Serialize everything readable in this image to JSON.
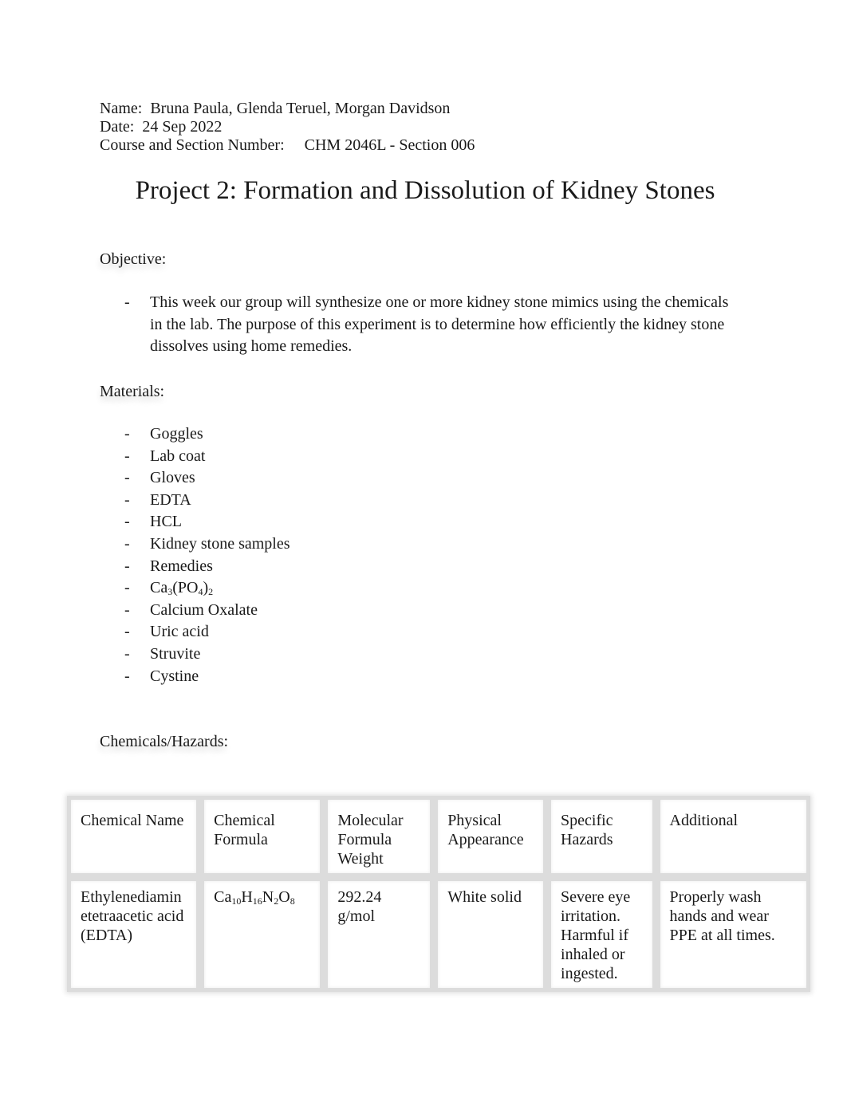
{
  "header": {
    "name_label": "Name:",
    "name_value": "Bruna Paula, Glenda Teruel, Morgan Davidson",
    "date_label": "Date:",
    "date_value": "24 Sep 2022",
    "course_label": "Course and Section Number:",
    "course_value": "CHM 2046L - Section 006"
  },
  "title": "Project 2: Formation and Dissolution of Kidney Stones",
  "objective": {
    "heading": "Objective:",
    "bullet": "-",
    "items": [
      "This week our group will synthesize one or more kidney stone mimics using the chemicals in the lab. The purpose of this experiment is to determine how efficiently the kidney stone dissolves using home remedies."
    ]
  },
  "materials": {
    "heading": "Materials:",
    "bullet": "-",
    "items": [
      "Goggles",
      "Lab coat",
      "Gloves",
      "EDTA",
      "HCL",
      "Kidney stone samples",
      "Remedies",
      {
        "formula": [
          [
            "Ca",
            ""
          ],
          [
            "",
            "3"
          ],
          [
            "(PO",
            ""
          ],
          [
            "",
            "4"
          ],
          [
            ")",
            ""
          ],
          [
            "",
            "2"
          ]
        ]
      },
      "Calcium Oxalate",
      "Uric acid",
      "Struvite",
      "Cystine"
    ],
    "formula_parts": {
      "ca": "Ca",
      "ca_sub": "3",
      "po": "(PO",
      "po_sub": "4",
      "close": ")",
      "close_sub": "2"
    }
  },
  "chemicals": {
    "heading": "Chemicals/Hazards:",
    "columns": [
      "Chemical Name",
      "Chemical Formula",
      "Molecular Formula Weight",
      "Physical Appearance",
      "Specific Hazards",
      "Additional"
    ],
    "rows": [
      {
        "name": "Ethylenediamin etetraacetic acid (EDTA)",
        "formula": {
          "p1": "Ca",
          "s1": "10",
          "p2": "H",
          "s2": "16",
          "p3": "N",
          "s3": "2",
          "p4": "O",
          "s4": "8"
        },
        "weight": "292.24 g/mol",
        "appearance": "White solid",
        "hazards": "Severe eye irritation. Harmful if inhaled or ingested.",
        "additional": "Properly wash hands and wear PPE at all times."
      }
    ]
  }
}
